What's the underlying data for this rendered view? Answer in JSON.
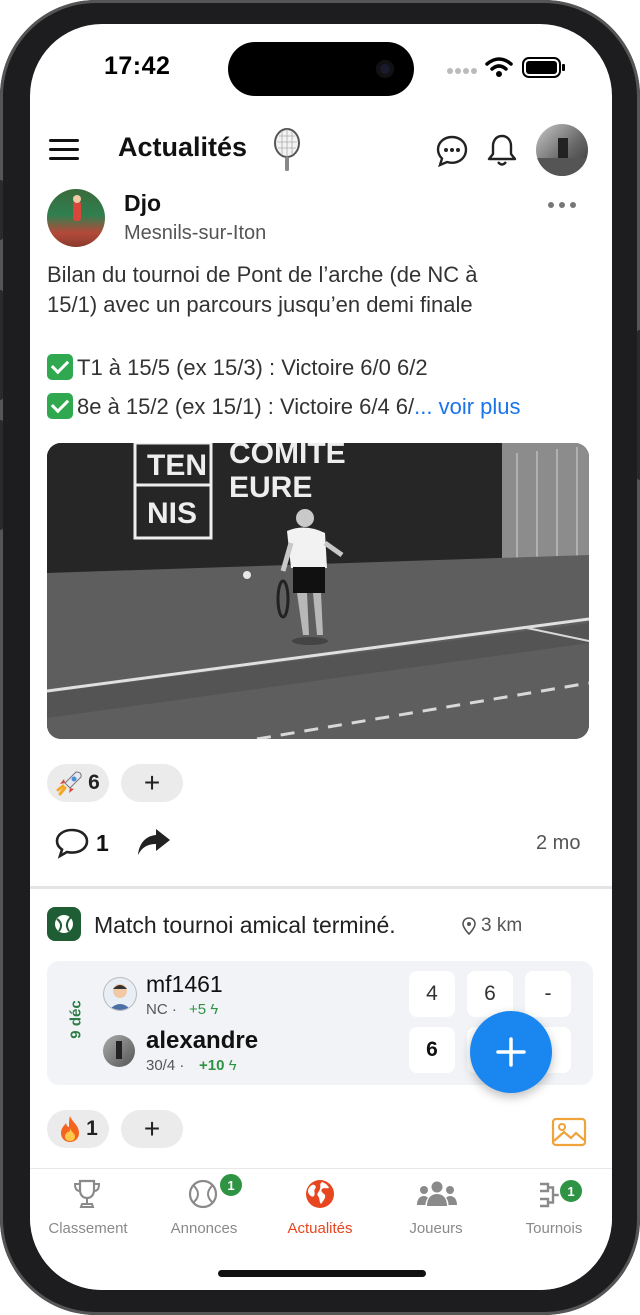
{
  "status_bar": {
    "time": "17:42"
  },
  "header": {
    "title": "Actualités"
  },
  "post": {
    "author": "Djo",
    "location": "Mesnils-sur-Iton",
    "text_line1": "Bilan du tournoi de Pont de l’arche (de NC à",
    "text_line2": "15/1) avec un parcours jusqu’en demi finale",
    "result1": "T1 à 15/5 (ex 15/3) : Victoire 6/0 6/2",
    "result2": "8e à 15/2 (ex 15/1) : Victoire 6/4 6/",
    "see_more": "... voir plus",
    "photo_sign_left_1": "TEN",
    "photo_sign_left_2": "NIS",
    "photo_sign_right_1": "COMITE",
    "photo_sign_right_2": "EURE",
    "reaction_count": "6",
    "add_reaction": "+",
    "comment_count": "1",
    "age": "2 mo"
  },
  "match": {
    "title": "Match tournoi amical terminé.",
    "distance": "3 km",
    "date": "9 déc",
    "player1": {
      "name": "mf1461",
      "rank": "NC ·",
      "points": "+5"
    },
    "player2": {
      "name": "alexandre",
      "rank": "30/4 ·",
      "points": "+10"
    },
    "scores1": [
      "4",
      "6",
      "-"
    ],
    "scores2": [
      "6",
      "",
      ""
    ],
    "reaction_count": "1",
    "add_reaction": "+"
  },
  "tabs": [
    {
      "label": "Classement",
      "icon": "trophy-icon"
    },
    {
      "label": "Annonces",
      "icon": "tennis-ball-icon",
      "badge": "1"
    },
    {
      "label": "Actualités",
      "icon": "globe-icon",
      "active": true
    },
    {
      "label": "Joueurs",
      "icon": "users-icon"
    },
    {
      "label": "Tournois",
      "icon": "bracket-icon",
      "badge": "1"
    }
  ],
  "colors": {
    "accent": "#e8461e",
    "badge": "#2e9444",
    "fab": "#1a86f0",
    "link": "#1a73e8"
  }
}
